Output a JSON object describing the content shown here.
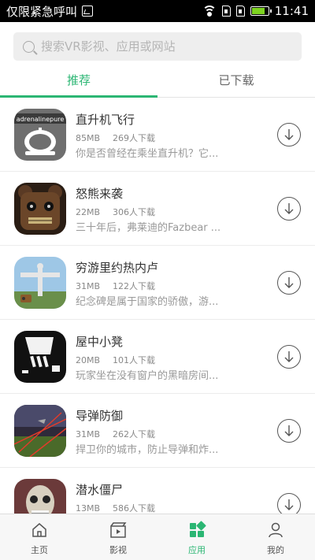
{
  "status_bar": {
    "carrier": "仅限紧急呼叫",
    "time": "11:41",
    "battery_color": "#7ed321"
  },
  "search": {
    "placeholder": "搜索VR影视、应用或网站"
  },
  "tabs": [
    {
      "label": "推荐",
      "active": true
    },
    {
      "label": "已下载",
      "active": false
    }
  ],
  "apps": [
    {
      "title": "直升机飞行",
      "size": "85MB",
      "downloads": "269人下载",
      "desc": "你是否曾经在乘坐直升机？它...",
      "thumb_text": "adrenalinepure"
    },
    {
      "title": "怒熊来袭",
      "size": "22MB",
      "downloads": "306人下载",
      "desc": "三十年后，弗莱迪的Fazbear ..."
    },
    {
      "title": "穷游里约热内卢",
      "size": "31MB",
      "downloads": "122人下载",
      "desc": "纪念碑是属于国家的骄傲，游..."
    },
    {
      "title": "屋中小凳",
      "size": "20MB",
      "downloads": "101人下载",
      "desc": "玩家坐在没有窗户的黑暗房间..."
    },
    {
      "title": "导弹防御",
      "size": "31MB",
      "downloads": "262人下载",
      "desc": "捍卫你的城市，防止导弹和炸..."
    },
    {
      "title": "潜水僵尸",
      "size": "13MB",
      "downloads": "586人下载",
      "desc": ""
    }
  ],
  "bottom_nav": [
    {
      "label": "主页",
      "icon": "home-icon",
      "active": false
    },
    {
      "label": "影视",
      "icon": "video-icon",
      "active": false
    },
    {
      "label": "应用",
      "icon": "apps-icon",
      "active": true
    },
    {
      "label": "我的",
      "icon": "profile-icon",
      "active": false
    }
  ],
  "accent_color": "#2bb673"
}
